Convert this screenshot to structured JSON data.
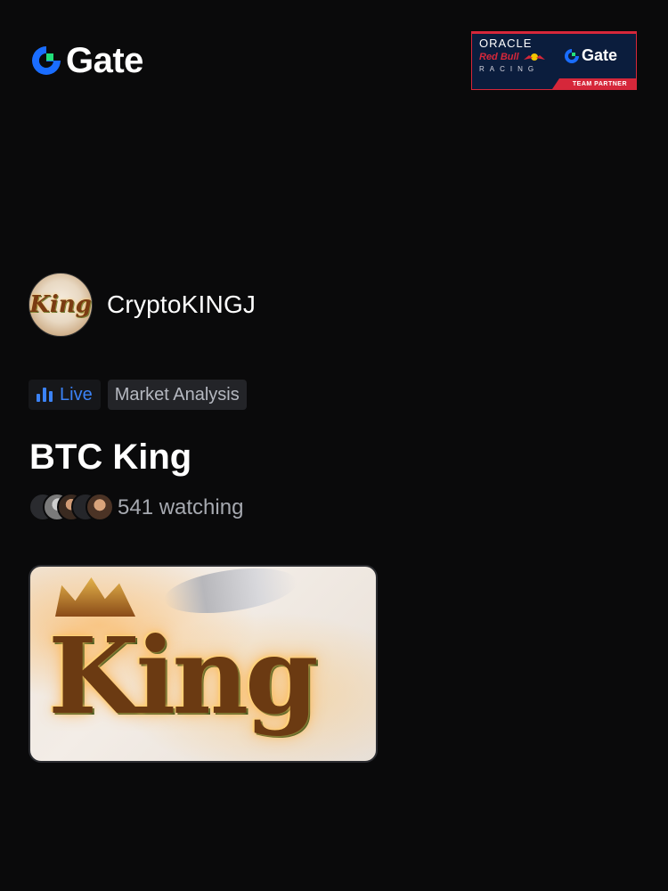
{
  "header": {
    "brand_name": "Gate",
    "partner_badge": {
      "oracle": "ORACLE",
      "redbull": "Red Bull",
      "racing": "RACING",
      "gate": "Gate",
      "partner_label": "TEAM PARTNER"
    }
  },
  "streamer": {
    "name": "CryptoKINGJ",
    "avatar_text": "King"
  },
  "tags": {
    "live_label": "Live",
    "category_label": "Market Analysis"
  },
  "stream": {
    "title": "BTC King",
    "watching_label": "541 watching",
    "thumbnail_text": "King"
  },
  "colors": {
    "background": "#0a0a0b",
    "gate_blue": "#1a6dff",
    "gate_green": "#22e07a",
    "live_blue": "#3b82f6",
    "redbull_red": "#d6273a"
  },
  "icons": {
    "live": "live-bars-icon",
    "brand": "gate-logo-icon"
  }
}
